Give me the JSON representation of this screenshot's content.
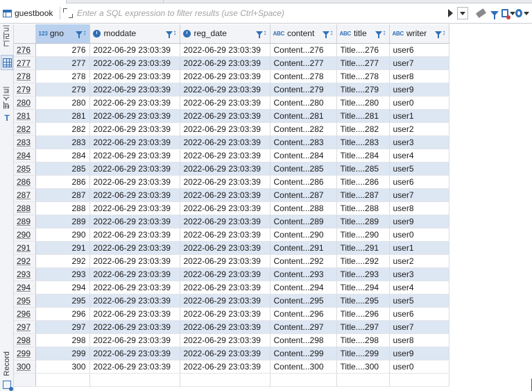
{
  "tabstrip": {
    "visible": true
  },
  "filter_bar": {
    "table_name": "guestbook",
    "placeholder": "Enter a SQL expression to filter results (use Ctrl+Space)"
  },
  "sidebar": {
    "items": [
      {
        "label": "그리드",
        "icon": "grid-icon",
        "active": true
      },
      {
        "label": "텍스트",
        "icon": "text-icon",
        "active": false
      },
      {
        "label": "Record",
        "icon": "record-icon",
        "active": false
      }
    ]
  },
  "grid": {
    "columns": [
      {
        "name": "gno",
        "type": "numeric",
        "type_badge": "123"
      },
      {
        "name": "moddate",
        "type": "datetime"
      },
      {
        "name": "reg_date",
        "type": "datetime"
      },
      {
        "name": "content",
        "type": "text",
        "type_badge": "ABC"
      },
      {
        "name": "title",
        "type": "text",
        "type_badge": "ABC"
      },
      {
        "name": "writer",
        "type": "text",
        "type_badge": "ABC"
      }
    ],
    "rows": [
      [
        "276",
        "276",
        "2022-06-29 23:03:39",
        "2022-06-29 23:03:39",
        "Content...276",
        "Title....276",
        "user6"
      ],
      [
        "277",
        "277",
        "2022-06-29 23:03:39",
        "2022-06-29 23:03:39",
        "Content...277",
        "Title....277",
        "user7"
      ],
      [
        "278",
        "278",
        "2022-06-29 23:03:39",
        "2022-06-29 23:03:39",
        "Content...278",
        "Title....278",
        "user8"
      ],
      [
        "279",
        "279",
        "2022-06-29 23:03:39",
        "2022-06-29 23:03:39",
        "Content...279",
        "Title....279",
        "user9"
      ],
      [
        "280",
        "280",
        "2022-06-29 23:03:39",
        "2022-06-29 23:03:39",
        "Content...280",
        "Title....280",
        "user0"
      ],
      [
        "281",
        "281",
        "2022-06-29 23:03:39",
        "2022-06-29 23:03:39",
        "Content...281",
        "Title....281",
        "user1"
      ],
      [
        "282",
        "282",
        "2022-06-29 23:03:39",
        "2022-06-29 23:03:39",
        "Content...282",
        "Title....282",
        "user2"
      ],
      [
        "283",
        "283",
        "2022-06-29 23:03:39",
        "2022-06-29 23:03:39",
        "Content...283",
        "Title....283",
        "user3"
      ],
      [
        "284",
        "284",
        "2022-06-29 23:03:39",
        "2022-06-29 23:03:39",
        "Content...284",
        "Title....284",
        "user4"
      ],
      [
        "285",
        "285",
        "2022-06-29 23:03:39",
        "2022-06-29 23:03:39",
        "Content...285",
        "Title....285",
        "user5"
      ],
      [
        "286",
        "286",
        "2022-06-29 23:03:39",
        "2022-06-29 23:03:39",
        "Content...286",
        "Title....286",
        "user6"
      ],
      [
        "287",
        "287",
        "2022-06-29 23:03:39",
        "2022-06-29 23:03:39",
        "Content...287",
        "Title....287",
        "user7"
      ],
      [
        "288",
        "288",
        "2022-06-29 23:03:39",
        "2022-06-29 23:03:39",
        "Content...288",
        "Title....288",
        "user8"
      ],
      [
        "289",
        "289",
        "2022-06-29 23:03:39",
        "2022-06-29 23:03:39",
        "Content...289",
        "Title....289",
        "user9"
      ],
      [
        "290",
        "290",
        "2022-06-29 23:03:39",
        "2022-06-29 23:03:39",
        "Content...290",
        "Title....290",
        "user0"
      ],
      [
        "291",
        "291",
        "2022-06-29 23:03:39",
        "2022-06-29 23:03:39",
        "Content...291",
        "Title....291",
        "user1"
      ],
      [
        "292",
        "292",
        "2022-06-29 23:03:39",
        "2022-06-29 23:03:39",
        "Content...292",
        "Title....292",
        "user2"
      ],
      [
        "293",
        "293",
        "2022-06-29 23:03:39",
        "2022-06-29 23:03:39",
        "Content...293",
        "Title....293",
        "user3"
      ],
      [
        "294",
        "294",
        "2022-06-29 23:03:39",
        "2022-06-29 23:03:39",
        "Content...294",
        "Title....294",
        "user4"
      ],
      [
        "295",
        "295",
        "2022-06-29 23:03:39",
        "2022-06-29 23:03:39",
        "Content...295",
        "Title....295",
        "user5"
      ],
      [
        "296",
        "296",
        "2022-06-29 23:03:39",
        "2022-06-29 23:03:39",
        "Content...296",
        "Title....296",
        "user6"
      ],
      [
        "297",
        "297",
        "2022-06-29 23:03:39",
        "2022-06-29 23:03:39",
        "Content...297",
        "Title....297",
        "user7"
      ],
      [
        "298",
        "298",
        "2022-06-29 23:03:39",
        "2022-06-29 23:03:39",
        "Content...298",
        "Title....298",
        "user8"
      ],
      [
        "299",
        "299",
        "2022-06-29 23:03:39",
        "2022-06-29 23:03:39",
        "Content...299",
        "Title....299",
        "user9"
      ],
      [
        "300",
        "300",
        "2022-06-29 23:03:39",
        "2022-06-29 23:03:39",
        "Content...300",
        "Title....300",
        "user0"
      ]
    ]
  },
  "colors": {
    "accent": "#2f6fb8",
    "row_stripe": "#dde6f3",
    "header_bg": "#f3f4f7",
    "selected_header": "#b9d1ee"
  }
}
